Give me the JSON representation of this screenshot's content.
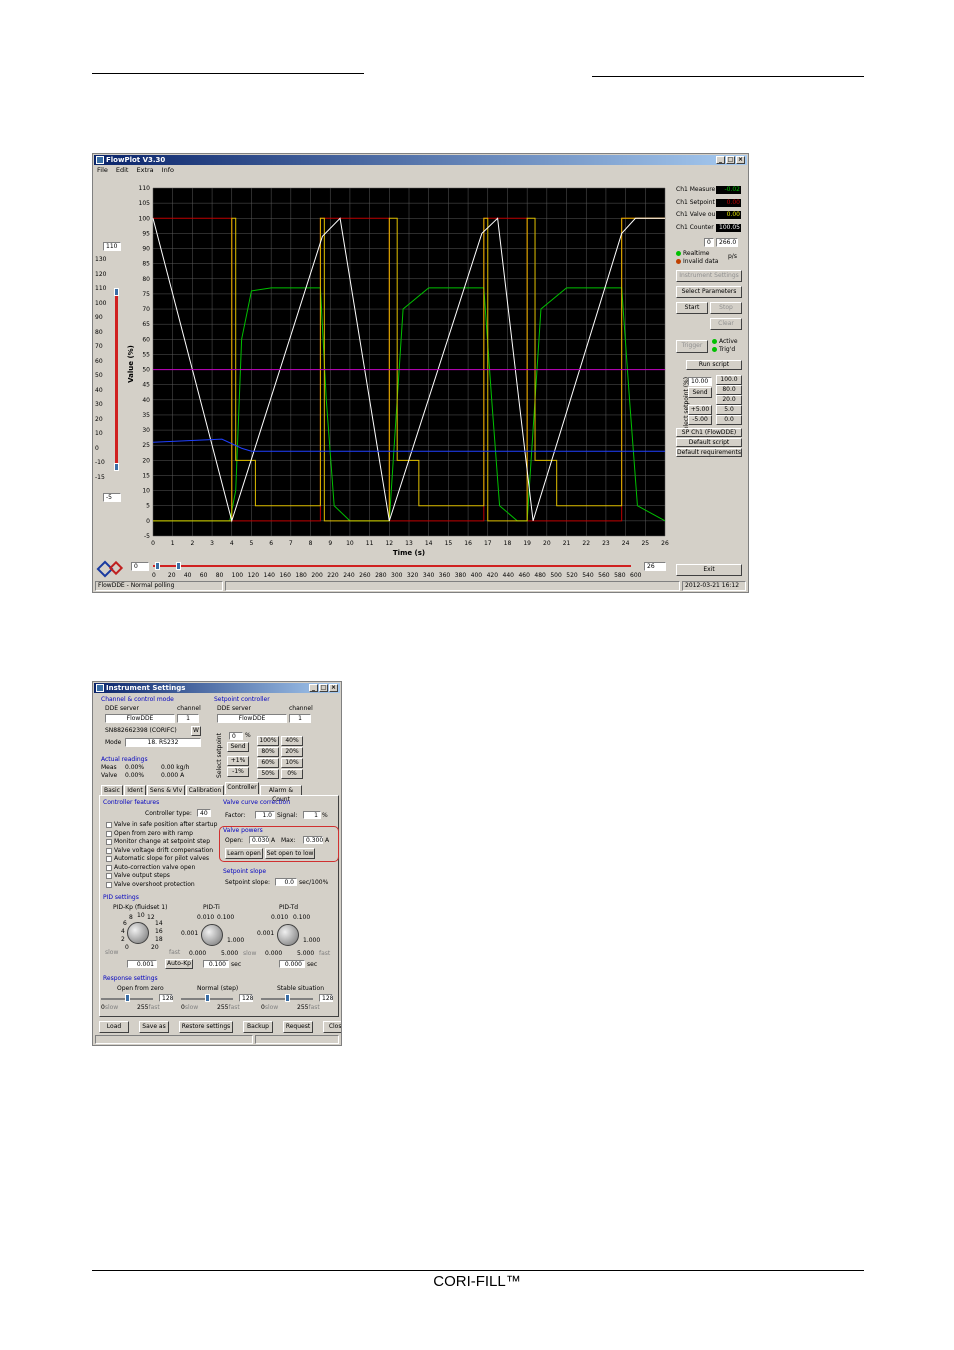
{
  "footer": {
    "product": "CORI-FILL™"
  },
  "flowplot": {
    "title": "FlowPlot V3.30",
    "menu": [
      "File",
      "Edit",
      "Extra",
      "Info"
    ],
    "yaxis_label": "Value (%)",
    "xaxis_label": "Time (s)",
    "y_ticks": [
      "110",
      "105",
      "100",
      "95",
      "90",
      "85",
      "80",
      "75",
      "70",
      "65",
      "60",
      "55",
      "50",
      "45",
      "40",
      "35",
      "30",
      "25",
      "20",
      "15",
      "10",
      "5",
      "0",
      "-5"
    ],
    "x_ticks": [
      "0",
      "1",
      "2",
      "3",
      "4",
      "5",
      "6",
      "7",
      "8",
      "9",
      "10",
      "11",
      "12",
      "13",
      "14",
      "15",
      "16",
      "17",
      "18",
      "19",
      "20",
      "21",
      "22",
      "23",
      "24",
      "25",
      "26"
    ],
    "left_ticks": [
      "130",
      "120",
      "110",
      "100",
      "90",
      "80",
      "70",
      "60",
      "50",
      "40",
      "30",
      "20",
      "10",
      "0",
      "-10",
      "-15"
    ],
    "ymax_value": "110",
    "ymin_value": "-5",
    "left_slider_top_label": "130",
    "bottom_ticks": [
      "0",
      "20",
      "40",
      "60",
      "80",
      "100",
      "120",
      "140",
      "160",
      "180",
      "200",
      "220",
      "240",
      "260",
      "280",
      "300",
      "320",
      "340",
      "360",
      "380",
      "400",
      "420",
      "440",
      "460",
      "480",
      "500",
      "520",
      "540",
      "560",
      "580",
      "600"
    ],
    "scroll_start": "0",
    "scroll_end": "26",
    "readouts": [
      {
        "label": "Ch1 Measure",
        "value": "-0.02",
        "color": "#00c000"
      },
      {
        "label": "Ch1 Setpoint",
        "value": "0.00",
        "color": "#c00000"
      },
      {
        "label": "Ch1 Valve ou",
        "value": "0.00",
        "color": "#e0e000"
      },
      {
        "label": "Ch1 Counter",
        "value": "100.05",
        "color": "#ffffff"
      }
    ],
    "rate_field": "0",
    "rate_value": "266.0",
    "rate_unit": "p/s",
    "status_realtime": "Realtime",
    "status_invalid": "Invalid data",
    "btn_instrument": "Instrument Settings",
    "btn_select_params": "Select Parameters",
    "btn_start": "Start",
    "btn_stop": "Stop",
    "btn_clear": "Clear",
    "btn_trigger": "Trigger",
    "trigger_active": "Active",
    "trigger_trigd": "Trig'd",
    "btn_run_script": "Run script",
    "select_setpoint_label": "Select setpoint (%)",
    "setpoint_value": "10.00",
    "btn_send": "Send",
    "sp_presets": [
      "100.0",
      "80.0",
      "20.0",
      "5.0",
      "0.0"
    ],
    "sp_plus": "+5.00",
    "sp_minus": "-5.00",
    "sp_ch": "SP Ch1 (FlowDDE)",
    "default_script": "Default script",
    "default_req": "Default requirements",
    "btn_exit": "Exit",
    "status_left": "FlowDDE - Normal polling",
    "status_right": "2012-03-21  16:12"
  },
  "chart_data": {
    "type": "line",
    "xlabel": "Time (s)",
    "ylabel": "Value (%)",
    "xlim": [
      0,
      26
    ],
    "ylim": [
      -5,
      110
    ],
    "grid": true,
    "series": [
      {
        "name": "Ch1 Setpoint",
        "color": "#c00000",
        "x": [
          0,
          4,
          4,
          8.5,
          8.5,
          12,
          12,
          16.8,
          16.8,
          19,
          19,
          23.8,
          23.8,
          26
        ],
        "values": [
          100,
          100,
          0,
          0,
          100,
          100,
          0,
          0,
          100,
          100,
          0,
          0,
          100,
          100
        ]
      },
      {
        "name": "Ch1 Measure",
        "color": "#00c000",
        "x": [
          0,
          3.9,
          4.2,
          4.5,
          5,
          6,
          8.5,
          8.8,
          9.2,
          10,
          12,
          12.3,
          12.7,
          14,
          16.8,
          17.2,
          17.6,
          18.5,
          19,
          19.3,
          19.7,
          21,
          23.8,
          24.2,
          24.6,
          26
        ],
        "values": [
          0,
          0,
          10,
          60,
          76,
          77,
          77,
          40,
          5,
          0,
          0,
          30,
          70,
          77,
          77,
          40,
          5,
          0,
          0,
          30,
          70,
          77,
          77,
          40,
          5,
          0
        ]
      },
      {
        "name": "Ch1 Valve output",
        "color": "#e0c000",
        "x": [
          0,
          4,
          4,
          4.2,
          4.2,
          5.2,
          5.2,
          8.5,
          8.5,
          8.7,
          8.7,
          12,
          12,
          12.4,
          12.4,
          13.5,
          13.5,
          16.8,
          16.8,
          17,
          17,
          19,
          19,
          19.4,
          19.4,
          20.5,
          20.5,
          23.8,
          23.8,
          26
        ],
        "values": [
          0,
          0,
          100,
          100,
          20,
          20,
          5,
          5,
          100,
          100,
          0,
          0,
          100,
          100,
          20,
          20,
          5,
          5,
          100,
          100,
          0,
          0,
          100,
          100,
          20,
          20,
          5,
          5,
          100,
          100
        ]
      },
      {
        "name": "Ch1 Counter",
        "color": "#ffffff",
        "x": [
          0,
          4,
          8.6,
          9.5,
          12,
          16.7,
          17.5,
          19.3,
          23.8,
          24.5,
          26
        ],
        "values": [
          100,
          0,
          94,
          100,
          0,
          95,
          100,
          0,
          95,
          100,
          100
        ]
      },
      {
        "name": "Magenta",
        "color": "#c000c0",
        "x": [
          0,
          26
        ],
        "values": [
          50,
          50
        ]
      },
      {
        "name": "Blue",
        "color": "#2040ff",
        "x": [
          0,
          3.5,
          4.5,
          5,
          26
        ],
        "values": [
          26,
          27,
          24,
          23,
          23
        ]
      }
    ]
  },
  "instrument": {
    "title": "Instrument Settings",
    "grp_channel": "Channel & control mode",
    "dde_server_label": "DDE server",
    "channel_label": "channel",
    "dde_server_value": "FlowDDE",
    "channel_value": "1",
    "serial": "SN882662398 (CORIFC)",
    "serial_btn": "W",
    "mode_label": "Mode",
    "mode_value": "18. RS232",
    "grp_setpoint": "Setpoint controller",
    "sp_dde_label": "DDE server",
    "sp_channel_label": "channel",
    "sp_dde_value": "FlowDDE",
    "sp_channel_value": "1",
    "sp_field": "0",
    "sp_unit": "%",
    "sp_send": "Send",
    "sp_vert_label": "Select setpoint",
    "sp_grid": [
      "100%",
      "40%",
      "80%",
      "20%",
      "60%",
      "10%",
      "50%",
      "0%"
    ],
    "sp_plus": "+1%",
    "sp_minus": "-1%",
    "grp_actual": "Actual readings",
    "meas_label": "Meas",
    "meas_pct": "0.00%",
    "meas_val": "0.00 kg/h",
    "valve_label": "Valve",
    "valve_pct": "0.00%",
    "valve_val": "0.000 A",
    "tabs": [
      "Basic",
      "Ident",
      "Sens & Vlv",
      "Calibration",
      "Controller",
      "Alarm & Count"
    ],
    "grp_ctrl_features": "Controller features",
    "ctrl_type_label": "Controller type:",
    "ctrl_type_value": "40",
    "features": [
      "Valve in safe position after startup",
      "Open from zero with ramp",
      "Monitor change at setpoint step",
      "Valve voltage drift compensation",
      "Automatic slope for pilot valves",
      "Auto-correction valve open",
      "Valve output steps",
      "Valve overshoot protection"
    ],
    "grp_valve_curve": "Valve curve correction",
    "factor_label": "Factor:",
    "factor_value": "1.0",
    "signal_label": "Signal:",
    "signal_value": "1",
    "signal_unit": "%",
    "grp_valve_powers": "Valve powers",
    "open_label": "Open:",
    "open_value": "0.030",
    "open_unit": "A",
    "max_label": "Max:",
    "max_value": "0.300",
    "max_unit": "A",
    "learn_open": "Learn open",
    "set_open_low": "Set open to low",
    "grp_sp_slope": "Setpoint slope",
    "slope_label": "Setpoint slope:",
    "slope_value": "0.0",
    "slope_unit": "sec/100%",
    "grp_pid": "PID settings",
    "pid_kp_label": "PID-Kp (fluidset 1)",
    "pid_ti_label": "PID-Ti",
    "pid_td_label": "PID-Td",
    "kp_scale": [
      "8",
      "10",
      "12",
      "14",
      "6",
      "16",
      "4",
      "2",
      "18",
      "0",
      "20"
    ],
    "kp_slow": "slow",
    "kp_fast": "fast",
    "kp_value": "0.001",
    "autokp": "Auto-Kp",
    "ti_scale_top": [
      "0.010",
      "0.100"
    ],
    "ti_left": "0.001",
    "ti_right": "1.000",
    "ti_bottom": [
      "0.000",
      "5.000"
    ],
    "ti_value": "0.100",
    "ti_unit": "sec",
    "td_scale_top": [
      "0.010",
      "0.100"
    ],
    "td_left": "0.001",
    "td_right": "1.000",
    "td_bottom": [
      "0.000",
      "5.000"
    ],
    "td_slow": "slow",
    "td_fast": "fast",
    "td_value": "0.000",
    "td_unit": "sec",
    "grp_response": "Response settings",
    "resp": [
      {
        "label": "Open from zero",
        "value": "128",
        "level": 0.5
      },
      {
        "label": "Normal (step)",
        "value": "128",
        "level": 0.5
      },
      {
        "label": "Stable situation",
        "value": "128",
        "level": 0.5
      }
    ],
    "resp_min": "0",
    "resp_min_lbl": "slow",
    "resp_max": "255",
    "resp_max_lbl": "fast",
    "footer_btns": [
      "Load",
      "Save as",
      "Restore settings",
      "Backup",
      "Request",
      "Close"
    ]
  }
}
